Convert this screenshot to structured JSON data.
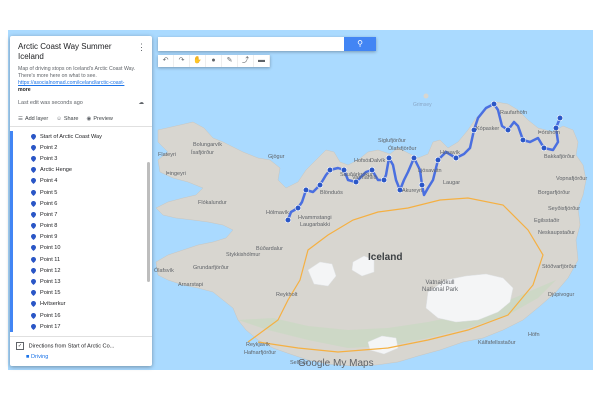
{
  "map": {
    "title": "Arctic Coast Way Summer Iceland",
    "description": "Map of driving stops on Iceland's Arctic Coast Way. There's more here on what to see.",
    "link": "https://asocialnomad.com/iceland/arctic-coast-",
    "more": "more",
    "last_edit": "Last edit was seconds ago"
  },
  "toolbar": {
    "add_layer": "Add layer",
    "share": "Share",
    "preview": "Preview"
  },
  "points": [
    "Start of Arctic Coast Way",
    "Point 2",
    "Point 3",
    "Arctic Henge",
    "Point 4",
    "Point 5",
    "Point 6",
    "Point 7",
    "Point 8",
    "Point 9",
    "Point 10",
    "Point 11",
    "Point 12",
    "Point 13",
    "Point 15",
    "Hvítserkur",
    "Point 16",
    "Point 17"
  ],
  "directions": {
    "title": "Directions from Start of Arctic Co...",
    "mode": "Driving"
  },
  "places": {
    "iceland": "Iceland",
    "vatnajokull": "Vatnajökull\nNational Park",
    "grimsey": "Grimsey",
    "raufarhofn": "Raufarhöfn",
    "bolungarvik": "Bolungarvík",
    "isafjordur": "Ísafjörður",
    "flateyri": "Flateyri",
    "thingeyri": "Þingeyri",
    "flokalundur": "Flókalundur",
    "holmavik": "Hólmavík",
    "budardalur": "Búðardalur",
    "grundarfjordur": "Grundarfjörður",
    "stykkisholmur": "Stykkishólmur",
    "olafsvik": "Ólafsvík",
    "arnarstapi": "Arnarstapi",
    "reykholt": "Reykholt",
    "reykjavik": "Reykjavík",
    "hafnarfjordur": "Hafnarfjörður",
    "selfoss": "Selfoss",
    "dalvik": "Dalvík",
    "akureyri": "Akureyri",
    "husavik": "Húsavík",
    "siglufjordur": "Siglufjörður",
    "olafsfjordur": "Ólafsfjörður",
    "blondusos": "Blönduós",
    "hvammstangi": "Hvammstangi",
    "laugarbakki": "Laugarbakki",
    "varmahlid": "Varmahlíð",
    "laugar": "Laugar",
    "egilsstadir": "Egilsstaðir",
    "neskaupstadur": "Neskaupstaður",
    "seydisfjordur": "Seyðisfjörður",
    "borgarfjordur": "Borgarfjörður",
    "hofn": "Höfn",
    "kalfafellsstadur": "Kálfafellsstaður",
    "stodvarfjordur": "Stöðvarfjörður",
    "djupivogur": "Djúpivogur",
    "thorshofn": "Þórshöfn",
    "bakkafjordur": "Bakkafjörður",
    "vopnafjordur": "Vopnafjörður",
    "kopasker": "Kópasker",
    "gjogur": "Gjögur",
    "hofsos": "Hofsós",
    "saudarkrokur": "Sauðárkrókur",
    "ljosavatn": "Ljósavatn",
    "google": "Google My Maps"
  },
  "colors": {
    "route": "#4a6fe0",
    "pin": "#2a56c6",
    "water": "#aadaff",
    "land": "#d8d6d0"
  }
}
